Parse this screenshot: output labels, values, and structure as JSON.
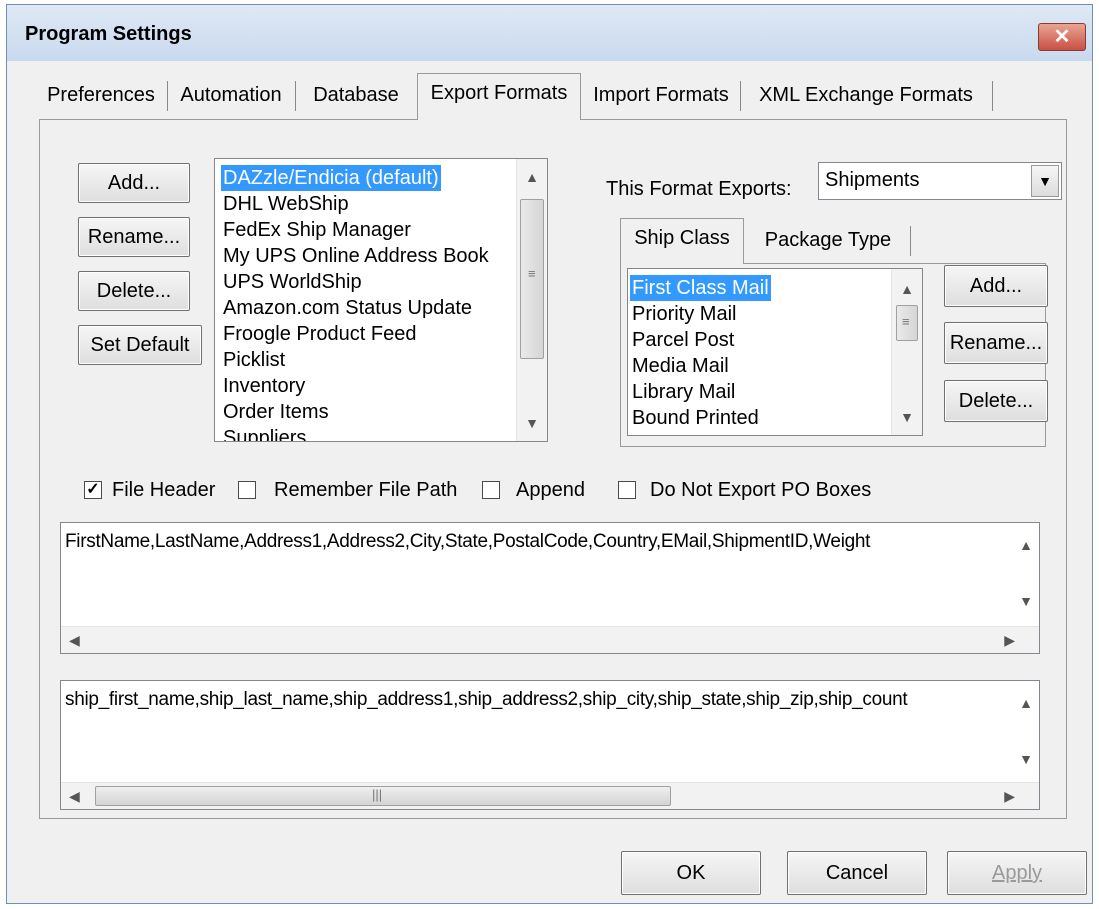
{
  "window": {
    "title": "Program Settings",
    "close_glyph": "✕"
  },
  "tabs": [
    {
      "label": "Preferences"
    },
    {
      "label": "Automation"
    },
    {
      "label": "Database"
    },
    {
      "label": "Export Formats",
      "active": true
    },
    {
      "label": "Import Formats"
    },
    {
      "label": "XML Exchange Formats"
    }
  ],
  "format_buttons": {
    "add": "Add...",
    "rename": "Rename...",
    "delete": "Delete...",
    "set_default": "Set Default"
  },
  "formats_list": {
    "items": [
      "DAZzle/Endicia (default)",
      "DHL WebShip",
      "FedEx Ship Manager",
      "My UPS Online Address Book",
      "UPS WorldShip",
      "Amazon.com Status Update",
      "Froogle Product Feed",
      "Picklist",
      "Inventory",
      "Order Items",
      "Suppliers"
    ],
    "selected_index": 0
  },
  "exports": {
    "label": "This Format Exports:",
    "value": "Shipments"
  },
  "subtabs": [
    {
      "label": "Ship Class",
      "active": true
    },
    {
      "label": "Package Type"
    }
  ],
  "ship_class_list": {
    "items": [
      "First Class Mail",
      "Priority Mail",
      "Parcel Post",
      "Media Mail",
      "Library Mail",
      "Bound Printed"
    ],
    "selected_index": 0
  },
  "class_buttons": {
    "add": "Add...",
    "rename": "Rename...",
    "delete": "Delete..."
  },
  "options": [
    {
      "label": "File Header",
      "checked": true
    },
    {
      "label": "Remember File Path",
      "checked": false
    },
    {
      "label": "Append",
      "checked": false
    },
    {
      "label": "Do Not Export PO Boxes",
      "checked": false
    }
  ],
  "header_text": "FirstName,LastName,Address1,Address2,City,State,PostalCode,Country,EMail,ShipmentID,Weight",
  "fields_text": "ship_first_name,ship_last_name,ship_address1,ship_address2,ship_city,ship_state,ship_zip,ship_count",
  "footer": {
    "ok": "OK",
    "cancel": "Cancel",
    "apply": "Apply"
  }
}
